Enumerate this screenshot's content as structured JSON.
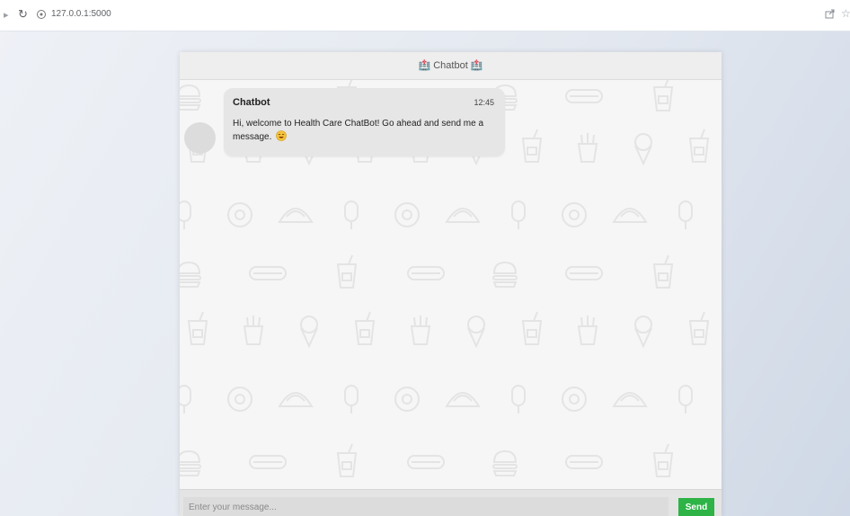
{
  "browser": {
    "url": "127.0.0.1:5000"
  },
  "chat": {
    "header_icon": "hospital-icon",
    "title": "Chatbot",
    "messages": [
      {
        "sender": "Chatbot",
        "time": "12:45",
        "text": "Hi, welcome to Health Care ChatBot! Go ahead and send me a message.",
        "emoji": "smiling-face-emoji"
      }
    ],
    "input": {
      "placeholder": "Enter your message...",
      "value": ""
    },
    "send_label": "Send"
  },
  "colors": {
    "send_button": "#2db346",
    "bubble": "#e6e6e6",
    "background": "#f6f6f6"
  }
}
